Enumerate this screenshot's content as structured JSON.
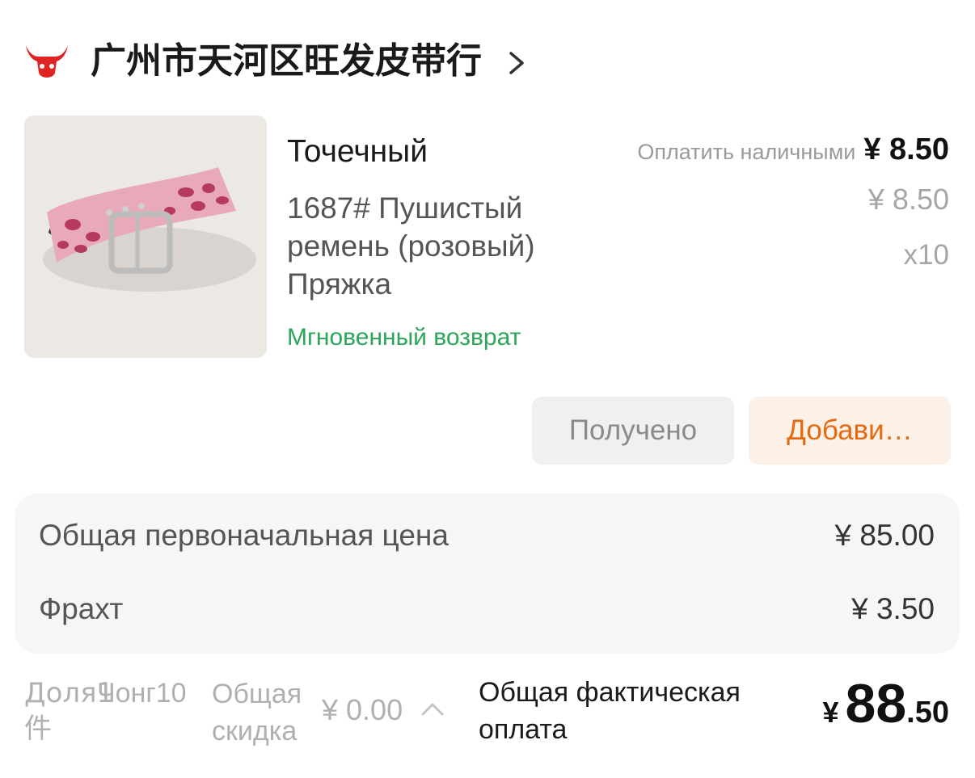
{
  "shop": {
    "name": "广州市天河区旺发皮带行",
    "logo_icon": "bull-head-icon",
    "chevron_icon": "chevron-right-icon",
    "brand_color": "#e02424"
  },
  "product": {
    "type": "Точечный",
    "description": "1687# Пушистый ремень (розовый) Пряжка",
    "return_tag": "Мгновенный возврат",
    "price_caption": "Оплатить наличными",
    "price_paid": "¥ 8.50",
    "price_unit": "¥ 8.50",
    "quantity": "x10",
    "image_icon": "pink-leopard-belt-image"
  },
  "actions": {
    "received_label": "Получено",
    "add_label": "Добави…",
    "add_color": "#e46a12"
  },
  "summary": {
    "original_total_label": "Общая первоначальная цена",
    "original_total_value": "¥ 85.00",
    "freight_label": "Фрахт",
    "freight_value": "¥ 3.50"
  },
  "footer": {
    "share_label": "Доля1件",
    "count_label": "Чонг10",
    "discount_label": "Общая скидка",
    "discount_value": "¥ 0.00",
    "discount_chevron_icon": "chevron-up-icon",
    "total_label": "Общая фактическая оплата",
    "total_currency": "¥",
    "total_integer": "88",
    "total_decimal": ".50"
  }
}
